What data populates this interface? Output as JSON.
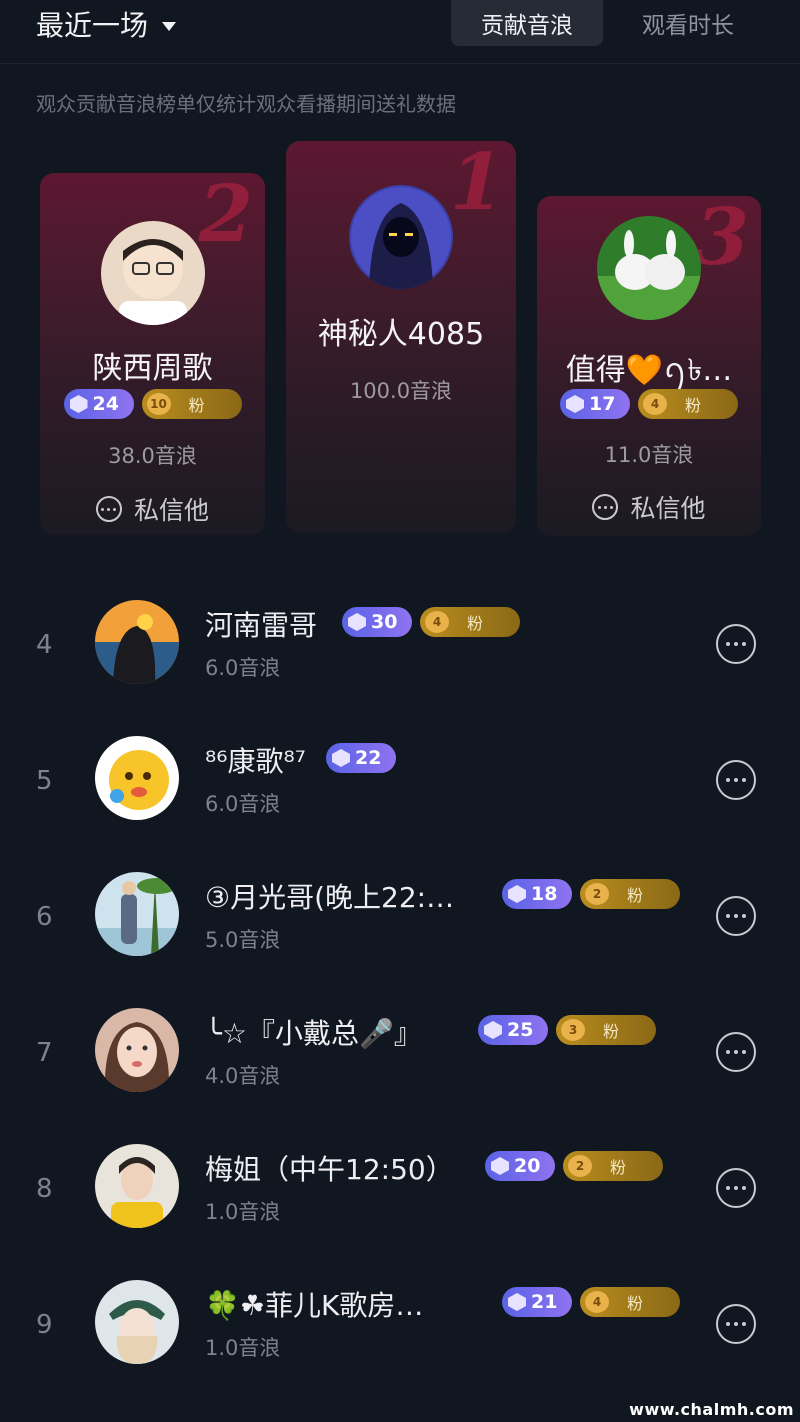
{
  "header": {
    "period_label": "最近一场",
    "tabs": [
      {
        "label": "贡献音浪",
        "active": true
      },
      {
        "label": "观看时长",
        "active": false
      }
    ],
    "notice": "观众贡献音浪榜单仅统计观众看播期间送礼数据"
  },
  "podium": [
    {
      "rank": "2",
      "name": "陕西周歌",
      "level": "24",
      "fan_level": "10",
      "fan_label": "粉",
      "amount": "38.0音浪",
      "message_label": "私信他"
    },
    {
      "rank": "1",
      "name": "神秘人4085",
      "amount": "100.0音浪"
    },
    {
      "rank": "3",
      "name": "值得🧡ꪆ৳…",
      "level": "17",
      "fan_level": "4",
      "fan_label": "粉",
      "amount": "11.0音浪",
      "message_label": "私信他"
    }
  ],
  "list": [
    {
      "rank": "4",
      "name": "河南雷哥",
      "level": "30",
      "fan_level": "4",
      "fan_label": "粉",
      "amount": "6.0音浪"
    },
    {
      "rank": "5",
      "name": "⁸⁶康歌⁸⁷",
      "level": "22",
      "amount": "6.0音浪"
    },
    {
      "rank": "6",
      "name": "③月光哥(晚上22:…",
      "level": "18",
      "fan_level": "2",
      "fan_label": "粉",
      "amount": "5.0音浪"
    },
    {
      "rank": "7",
      "name": "╰☆『小戴总🎤』",
      "level": "25",
      "fan_level": "3",
      "fan_label": "粉",
      "amount": "4.0音浪"
    },
    {
      "rank": "8",
      "name": "梅姐（中午12:50）",
      "level": "20",
      "fan_level": "2",
      "fan_label": "粉",
      "amount": "1.0音浪"
    },
    {
      "rank": "9",
      "name": "🍀☘菲儿K歌房…",
      "level": "21",
      "fan_level": "4",
      "fan_label": "粉",
      "amount": "1.0音浪"
    }
  ],
  "watermark": "www.chalmh.com",
  "colors": {
    "background": "#111720",
    "level_badge": "#6b68ec",
    "fan_badge": "#b98d1e",
    "podium_accent": "#a4203f"
  }
}
